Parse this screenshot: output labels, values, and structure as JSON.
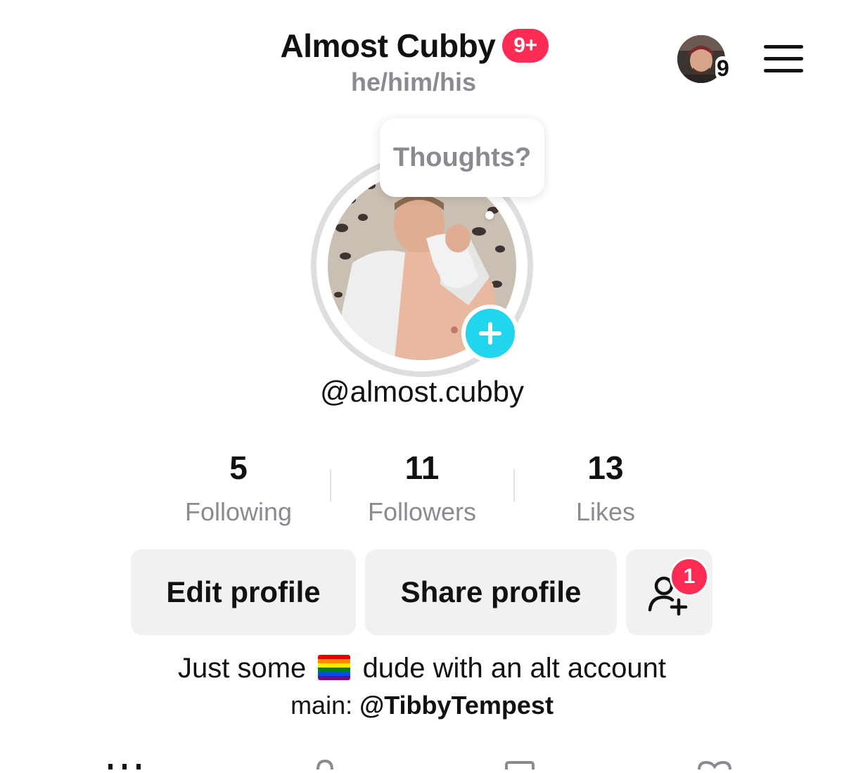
{
  "header": {
    "display_name": "Almost Cubby",
    "notifications_badge": "9+",
    "pronouns": "he/him/his",
    "account_switch_count": "9",
    "menu_icon": "hamburger-menu-icon"
  },
  "profile": {
    "thought_bubble": "Thoughts?",
    "username": "@almost.cubby",
    "add_story_icon": "plus-icon"
  },
  "stats": [
    {
      "value": "5",
      "label": "Following"
    },
    {
      "value": "11",
      "label": "Followers"
    },
    {
      "value": "13",
      "label": "Likes"
    }
  ],
  "actions": {
    "edit_profile": "Edit profile",
    "share_profile": "Share profile",
    "friend_requests_icon": "add-friend-icon",
    "friend_requests_count": "1"
  },
  "bio": {
    "line1_before": "Just some",
    "line1_after": "dude with an alt account",
    "line2_prefix": "main:",
    "line2_handle": "@TibbyTempest"
  },
  "colors": {
    "accent_red": "#fe2c55",
    "story_cyan": "#20d5ec",
    "secondary_text": "#8a8b91",
    "button_bg": "#f1f1f2"
  }
}
